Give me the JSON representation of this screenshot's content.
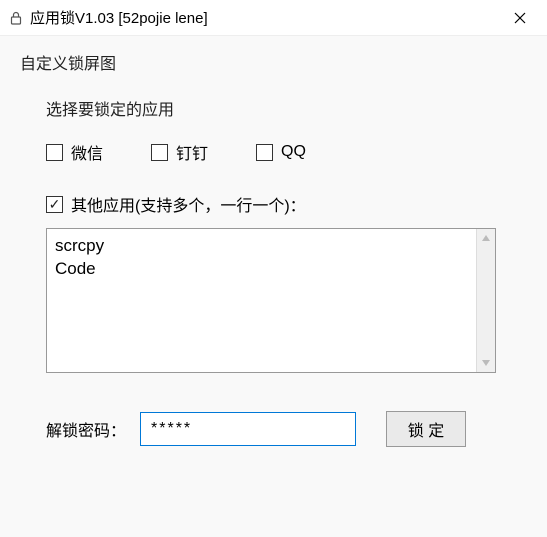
{
  "titlebar": {
    "title": "应用锁V1.03 [52pojie lene]"
  },
  "section": {
    "custom_lock_image": "自定义锁屏图",
    "select_apps": "选择要锁定的应用"
  },
  "apps": {
    "wechat": {
      "label": "微信",
      "checked": false
    },
    "dingtalk": {
      "label": "钉钉",
      "checked": false
    },
    "qq": {
      "label": "QQ",
      "checked": false
    }
  },
  "other": {
    "label": "其他应用(支持多个，一行一个)：",
    "checked": true,
    "value": "scrcpy\nCode"
  },
  "password": {
    "label": "解锁密码：",
    "value": "*****"
  },
  "lock_button": "锁 定"
}
